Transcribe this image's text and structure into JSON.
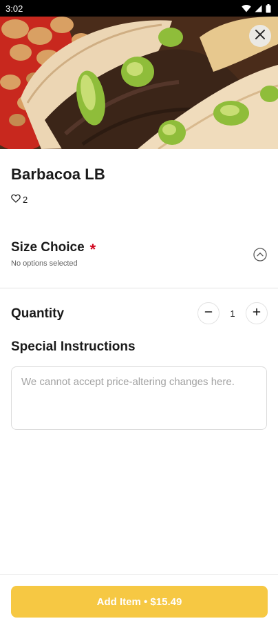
{
  "status_bar": {
    "time": "3:02",
    "icons": [
      "wifi-icon",
      "cellular-signal-icon",
      "battery-icon"
    ]
  },
  "hero": {
    "image": "barbacoa-tacos-photo",
    "close_icon": "close-icon"
  },
  "item": {
    "name": "Barbacoa LB",
    "likes_count": "2",
    "likes_icon": "heart-outline-icon"
  },
  "size_choice": {
    "title": "Size Choice",
    "required_marker": "*",
    "subtitle": "No options selected",
    "toggle_icon": "chevron-up-circle-icon"
  },
  "quantity": {
    "label": "Quantity",
    "value": "1",
    "decrement_icon": "minus-icon",
    "increment_icon": "plus-icon"
  },
  "special_instructions": {
    "label": "Special Instructions",
    "placeholder": "We cannot accept price-altering changes here.",
    "value": ""
  },
  "footer": {
    "add_button_label": "Add Item • $15.49"
  },
  "colors": {
    "accent": "#f6c843",
    "required": "#d0021b",
    "status_bar": "#000000"
  }
}
